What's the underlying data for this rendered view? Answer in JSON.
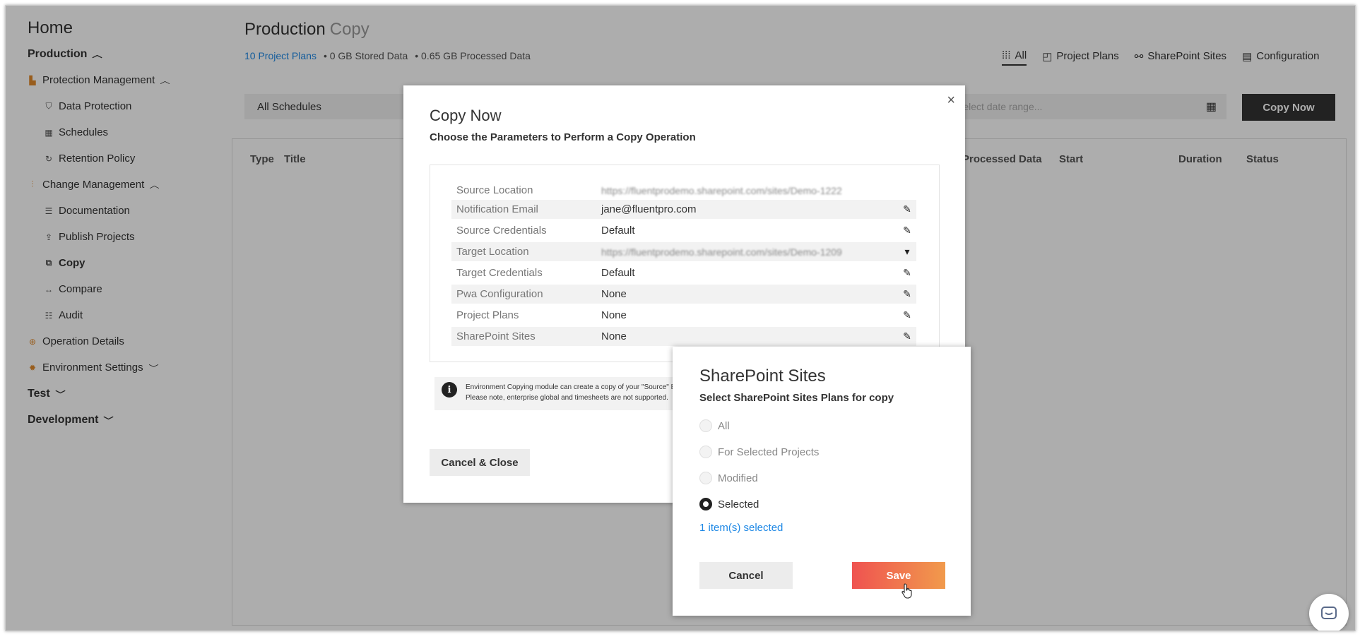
{
  "sidebar": {
    "home": "Home",
    "items": [
      {
        "label": "Production",
        "type": "section",
        "chevron": "up"
      },
      {
        "label": "Protection Management",
        "icon": "chart-icon",
        "chevron": "up"
      },
      {
        "label": "Data Protection",
        "icon": "shield-icon"
      },
      {
        "label": "Schedules",
        "icon": "calendar-icon"
      },
      {
        "label": "Retention Policy",
        "icon": "retention-icon"
      },
      {
        "label": "Change Management",
        "icon": "sliders-icon",
        "chevron": "up"
      },
      {
        "label": "Documentation",
        "icon": "document-icon"
      },
      {
        "label": "Publish Projects",
        "icon": "publish-icon"
      },
      {
        "label": "Copy",
        "icon": "copy-icon",
        "active": true
      },
      {
        "label": "Compare",
        "icon": "compare-icon"
      },
      {
        "label": "Audit",
        "icon": "audit-icon"
      },
      {
        "label": "Operation Details",
        "icon": "operation-icon"
      },
      {
        "label": "Environment Settings",
        "icon": "gear-icon",
        "chevron": "down"
      },
      {
        "label": "Test",
        "type": "section",
        "chevron": "down"
      },
      {
        "label": "Development",
        "type": "section",
        "chevron": "down"
      }
    ]
  },
  "header": {
    "title": "Production",
    "subtitle": "Copy",
    "project_plans_link": "10 Project Plans",
    "stored_data": "• 0 GB Stored Data",
    "processed_data": "• 0.65 GB Processed Data"
  },
  "tabs": [
    {
      "label": "All",
      "icon": "grid-icon",
      "active": true
    },
    {
      "label": "Project Plans",
      "icon": "project-plans-icon"
    },
    {
      "label": "SharePoint Sites",
      "icon": "sharepoint-icon"
    },
    {
      "label": "Configuration",
      "icon": "configuration-icon"
    }
  ],
  "filters": {
    "schedule_value": "All Schedules",
    "date_placeholder": "Select date range...",
    "copy_now_label": "Copy Now"
  },
  "table": {
    "columns": [
      "Type",
      "Title",
      "Processed Data",
      "Start",
      "Duration",
      "Status"
    ]
  },
  "copy_modal": {
    "title": "Copy Now",
    "subtitle": "Choose the Parameters to Perform a Copy Operation",
    "close": "×",
    "params": [
      {
        "label": "Source Location",
        "value": "https://fluentprodemo.sharepoint.com/sites/Demo-1222",
        "blurred": true,
        "action": ""
      },
      {
        "label": "Notification Email",
        "value": "jane@fluentpro.com",
        "action": "edit"
      },
      {
        "label": "Source Credentials",
        "value": "Default",
        "action": "edit"
      },
      {
        "label": "Target Location",
        "value": "https://fluentprodemo.sharepoint.com/sites/Demo-1209",
        "blurred": true,
        "action": "dropdown"
      },
      {
        "label": "Target Credentials",
        "value": "Default",
        "action": "edit"
      },
      {
        "label": "Pwa Configuration",
        "value": "None",
        "action": "edit"
      },
      {
        "label": "Project Plans",
        "value": "None",
        "action": "edit"
      },
      {
        "label": "SharePoint Sites",
        "value": "None",
        "action": "edit"
      }
    ],
    "info_line1": "Environment Copying module can create a copy of your \"Source\" En",
    "info_line2": "Please note, enterprise global and timesheets are not supported.",
    "cancel_label": "Cancel & Close"
  },
  "sharepoint_dialog": {
    "title": "SharePoint Sites",
    "subtitle": "Select SharePoint Sites Plans for copy",
    "options": [
      {
        "label": "All",
        "selected": false
      },
      {
        "label": "For Selected Projects",
        "selected": false
      },
      {
        "label": "Modified",
        "selected": false
      },
      {
        "label": "Selected",
        "selected": true
      }
    ],
    "selected_link": "1 item(s) selected",
    "cancel_label": "Cancel",
    "save_label": "Save"
  }
}
